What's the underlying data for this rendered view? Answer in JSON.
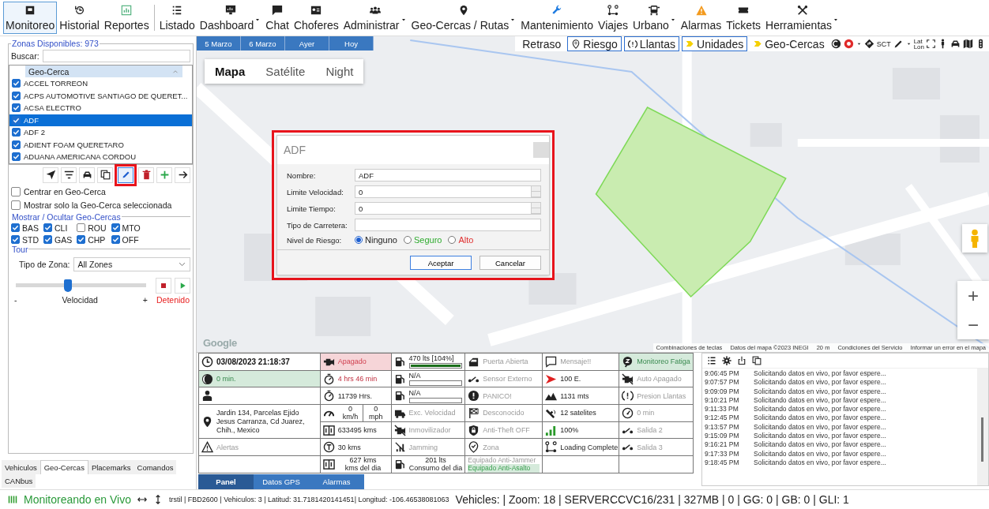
{
  "ribbon": [
    {
      "label": "Monitoreo",
      "selected": true,
      "menu": false
    },
    {
      "label": "Historial",
      "selected": false,
      "menu": false
    },
    {
      "label": "Reportes",
      "selected": false,
      "menu": false
    },
    {
      "label": "Listado",
      "selected": false,
      "menu": false
    },
    {
      "label": "Dashboard",
      "selected": false,
      "menu": true
    },
    {
      "label": "Chat",
      "selected": false,
      "menu": false
    },
    {
      "label": "Choferes",
      "selected": false,
      "menu": false
    },
    {
      "label": "Administrar",
      "selected": false,
      "menu": true
    },
    {
      "label": "Geo-Cercas / Rutas",
      "selected": false,
      "menu": true
    },
    {
      "label": "Mantenimiento",
      "selected": false,
      "menu": false
    },
    {
      "label": "Viajes",
      "selected": false,
      "menu": false
    },
    {
      "label": "Urbano",
      "selected": false,
      "menu": true
    },
    {
      "label": "Alarmas",
      "selected": false,
      "menu": false
    },
    {
      "label": "Tickets",
      "selected": false,
      "menu": false
    },
    {
      "label": "Herramientas",
      "selected": false,
      "menu": true
    }
  ],
  "zones": {
    "title": "Zonas Disponibles: 973",
    "search_label": "Buscar:",
    "column": "Geo-Cerca",
    "items": [
      {
        "label": "ACCEL TORREON",
        "checked": true,
        "selected": false
      },
      {
        "label": "ACPS AUTOMOTIVE SANTIAGO DE QUERET...",
        "checked": true,
        "selected": false
      },
      {
        "label": "ACSA ELECTRO",
        "checked": true,
        "selected": false
      },
      {
        "label": "ADF",
        "checked": true,
        "selected": true
      },
      {
        "label": "ADF 2",
        "checked": true,
        "selected": false
      },
      {
        "label": "ADIENT FOAM QUERETARO",
        "checked": true,
        "selected": false
      },
      {
        "label": "ADUANA AMERICANA CORDOU",
        "checked": true,
        "selected": false
      }
    ]
  },
  "tools": [
    {
      "highlighted": false
    },
    {
      "highlighted": false
    },
    {
      "highlighted": false
    },
    {
      "highlighted": false
    },
    {
      "highlighted": true
    },
    {
      "highlighted": false
    },
    {
      "highlighted": false
    },
    {
      "highlighted": false
    }
  ],
  "options": [
    {
      "label": "Centrar en Geo-Cerca",
      "checked": false
    },
    {
      "label": "Mostrar solo la Geo-Cerca seleccionada",
      "checked": false
    }
  ],
  "layers": {
    "title": "Mostrar / Ocultar Geo-Cercas",
    "items": [
      {
        "label": "BAS",
        "checked": true
      },
      {
        "label": "CLI",
        "checked": true
      },
      {
        "label": "ROU",
        "checked": false
      },
      {
        "label": "MTO",
        "checked": true
      },
      {
        "label": "STD",
        "checked": true
      },
      {
        "label": "GAS",
        "checked": true
      },
      {
        "label": "CHP",
        "checked": true
      },
      {
        "label": "OFF",
        "checked": true
      }
    ]
  },
  "tour": {
    "title": "Tour",
    "zone_type_label": "Tipo de Zona:",
    "zone_type": "All Zones",
    "speed": {
      "level": 0.4,
      "minus": "-",
      "label": "Velocidad",
      "plus": "+"
    },
    "status": "Detenido"
  },
  "left_tabs": [
    {
      "label": "Vehiculos",
      "selected": false
    },
    {
      "label": "Geo-Cercas",
      "selected": true
    },
    {
      "label": "Placemarks",
      "selected": false
    },
    {
      "label": "Comandos",
      "selected": false
    },
    {
      "label": "CANbus",
      "selected": false
    }
  ],
  "map": {
    "date_buttons": [
      "5 Marzo",
      "6 Marzo",
      "Ayer",
      "Hoy"
    ],
    "layer_buttons": [
      {
        "label": "Retraso",
        "boxed": false
      },
      {
        "label": "Riesgo",
        "boxed": true
      },
      {
        "label": "Llantas",
        "boxed": true
      },
      {
        "label": "Unidades",
        "boxed": true
      },
      {
        "label": "Geo-Cercas",
        "boxed": false
      }
    ],
    "tool_texts": {
      "sct": "SCT",
      "lat": "Lat",
      "lon": "Lon"
    },
    "types": [
      {
        "label": "Mapa",
        "selected": true
      },
      {
        "label": "Satélite",
        "selected": false
      },
      {
        "label": "Night",
        "selected": false
      }
    ],
    "zoom_in": "+",
    "zoom_out": "−",
    "logo": "Google",
    "attribution": [
      "Combinaciones de teclas",
      "Datos del mapa ©2023 INEGI",
      "20 m",
      "Condiciones del Servicio",
      "Informar un error en el mapa"
    ]
  },
  "dialog": {
    "title": "ADF",
    "highlighted": true,
    "fields": [
      {
        "kind": "text",
        "label": "Nombre:",
        "value": "ADF"
      },
      {
        "kind": "spin",
        "label": "Limite Velocidad:",
        "value": "0"
      },
      {
        "kind": "spin",
        "label": "Limite Tiempo:",
        "value": "0"
      },
      {
        "kind": "text",
        "label": "Tipo de Carretera:"
      }
    ],
    "risk_label": "Nivel de Riesgo:",
    "risk": [
      {
        "label": "Ninguno",
        "selected": true,
        "color": "#222222"
      },
      {
        "label": "Seguro",
        "selected": false,
        "color": "#2eab2e"
      },
      {
        "label": "Alto",
        "selected": false,
        "color": "#e03030"
      }
    ],
    "buttons": [
      {
        "label": "Aceptar",
        "focused": true
      },
      {
        "label": "Cancelar",
        "focused": false
      }
    ]
  },
  "panel": {
    "columns": [
      {
        "cells": [
          {
            "kind": "text",
            "text": "03/08/2023 21:18:37",
            "bold": true,
            "dimmed": false,
            "alarm": false,
            "filled": false
          },
          {
            "kind": "text",
            "text": "0 min.",
            "bold": false,
            "dimmed": false,
            "alarm": false,
            "filled": true
          },
          {
            "kind": "icon_only"
          },
          {
            "kind": "address",
            "text": "Jardin 134, Parcelas Ejido Jesus Carranza, Cd Juarez, Chih., Mexico"
          },
          {
            "kind": "text",
            "text": "Alertas",
            "bold": false,
            "dimmed": true,
            "alarm": false,
            "filled": false
          },
          {
            "kind": "empty"
          }
        ]
      },
      {
        "cells": [
          {
            "kind": "text",
            "text": "Apagado",
            "bold": false,
            "dimmed": false,
            "alarm": true,
            "filled": true
          },
          {
            "kind": "text",
            "text": "4 hrs 46 min",
            "bold": false,
            "dimmed": false,
            "alarm": true,
            "filled": false
          },
          {
            "kind": "text",
            "text": "11739 Hrs.",
            "bold": false,
            "dimmed": false,
            "alarm": false,
            "filled": false
          },
          {
            "kind": "speed",
            "values": [
              {
                "value": "0",
                "unit": "km/h"
              },
              {
                "value": "0",
                "unit": "mph"
              }
            ]
          },
          {
            "kind": "text",
            "text": "633495 kms",
            "bold": false,
            "dimmed": false,
            "alarm": false,
            "filled": false
          },
          {
            "kind": "text",
            "text": "30 kms",
            "bold": false,
            "dimmed": false,
            "alarm": false,
            "filled": false
          },
          {
            "kind": "two_line",
            "lines": [
              "627 kms",
              "kms del dia"
            ]
          }
        ]
      },
      {
        "cells": [
          {
            "kind": "fuel",
            "text": "470 lts [104%]",
            "level": 1
          },
          {
            "kind": "fuel",
            "text": "N/A"
          },
          {
            "kind": "fuel",
            "text": "N/A"
          },
          {
            "kind": "text",
            "text": "Exc. Velocidad",
            "bold": false,
            "dimmed": true,
            "alarm": false,
            "filled": false
          },
          {
            "kind": "text",
            "text": "Inmovilizador",
            "bold": false,
            "dimmed": true,
            "alarm": false,
            "filled": false
          },
          {
            "kind": "text",
            "text": "Jamming",
            "bold": false,
            "dimmed": true,
            "alarm": false,
            "filled": false
          },
          {
            "kind": "two_line",
            "lines": [
              "201 lts",
              "Consumo del dia"
            ]
          }
        ]
      },
      {
        "cells": [
          {
            "kind": "text",
            "text": "Puerta Abierta",
            "bold": false,
            "dimmed": true,
            "alarm": false,
            "filled": false
          },
          {
            "kind": "text",
            "text": "Sensor Externo",
            "bold": false,
            "dimmed": true,
            "alarm": false,
            "filled": false
          },
          {
            "kind": "text",
            "text": "PANICO!",
            "bold": false,
            "dimmed": true,
            "alarm": false,
            "filled": false
          },
          {
            "kind": "text",
            "text": "Desconocido",
            "bold": false,
            "dimmed": true,
            "alarm": false,
            "filled": false
          },
          {
            "kind": "text",
            "text": "Anti-Theft OFF",
            "bold": false,
            "dimmed": true,
            "alarm": false,
            "filled": false
          },
          {
            "kind": "text",
            "text": "Zona",
            "bold": false,
            "dimmed": true,
            "alarm": false,
            "filled": false
          },
          {
            "kind": "flags",
            "flags": [
              {
                "text": "Equipado Anti-Jammer",
                "on": false
              },
              {
                "text": "Equipado Anti-Asalto",
                "on": true
              }
            ]
          }
        ]
      },
      {
        "cells": [
          {
            "kind": "text",
            "text": "Mensaje!!",
            "bold": false,
            "dimmed": true,
            "alarm": false,
            "filled": false
          },
          {
            "kind": "text",
            "text": "100 E.",
            "bold": false,
            "dimmed": false,
            "alarm": false,
            "filled": false
          },
          {
            "kind": "text",
            "text": "1131 mts",
            "bold": false,
            "dimmed": false,
            "alarm": false,
            "filled": false
          },
          {
            "kind": "text",
            "text": "12 satelites",
            "bold": false,
            "dimmed": false,
            "alarm": false,
            "filled": false
          },
          {
            "kind": "text",
            "text": "100%",
            "bold": false,
            "dimmed": false,
            "alarm": false,
            "filled": false
          },
          {
            "kind": "text",
            "text": "Loading Complete",
            "bold": false,
            "dimmed": false,
            "alarm": false,
            "filled": false
          },
          {
            "kind": "empty"
          }
        ]
      },
      {
        "cells": [
          {
            "kind": "text",
            "text": "Monitoreo Fatiga",
            "bold": false,
            "dimmed": false,
            "alarm": false,
            "filled": true
          },
          {
            "kind": "text",
            "text": "Auto Apagado",
            "bold": false,
            "dimmed": true,
            "alarm": false,
            "filled": false
          },
          {
            "kind": "text",
            "text": "Presion Llantas",
            "bold": false,
            "dimmed": true,
            "alarm": false,
            "filled": false
          },
          {
            "kind": "text",
            "text": "0 min",
            "bold": false,
            "dimmed": true,
            "alarm": false,
            "filled": false
          },
          {
            "kind": "text",
            "text": "Salida 2",
            "bold": false,
            "dimmed": true,
            "alarm": false,
            "filled": false
          },
          {
            "kind": "text",
            "text": "Salida 3",
            "bold": false,
            "dimmed": true,
            "alarm": false,
            "filled": false
          },
          {
            "kind": "empty"
          }
        ]
      }
    ]
  },
  "panel_tabs": [
    {
      "label": "Panel",
      "selected": true
    },
    {
      "label": "Datos GPS",
      "selected": false
    },
    {
      "label": "Alarmas",
      "selected": false
    }
  ],
  "log": {
    "entries": [
      {
        "time": "9:06:45 PM",
        "message": "Solicitando datos en vivo, por favor espere..."
      },
      {
        "time": "9:07:57 PM",
        "message": "Solicitando datos en vivo, por favor espere..."
      },
      {
        "time": "9:09:09 PM",
        "message": "Solicitando datos en vivo, por favor espere..."
      },
      {
        "time": "9:10:21 PM",
        "message": "Solicitando datos en vivo, por favor espere..."
      },
      {
        "time": "9:11:33 PM",
        "message": "Solicitando datos en vivo, por favor espere..."
      },
      {
        "time": "9:12:45 PM",
        "message": "Solicitando datos en vivo, por favor espere..."
      },
      {
        "time": "9:13:57 PM",
        "message": "Solicitando datos en vivo, por favor espere..."
      },
      {
        "time": "9:15:09 PM",
        "message": "Solicitando datos en vivo, por favor espere..."
      },
      {
        "time": "9:16:21 PM",
        "message": "Solicitando datos en vivo, por favor espere..."
      },
      {
        "time": "9:17:33 PM",
        "message": "Solicitando datos en vivo, por favor espere..."
      },
      {
        "time": "9:18:45 PM",
        "message": "Solicitando datos en vivo, por favor espere..."
      }
    ]
  },
  "status_bar": {
    "live": "Monitoreando en Vivo",
    "details": "trstil | FBD2600 | Vehiculos: 3 | Latitud: 31.7181420141451| Longitud: -106.46538081063",
    "summary": "Vehicles: | Zoom: 18 | SERVERCCVC16/231 | 327MB | 0 | GG: 0 | GB: 0 | GLI: 1"
  }
}
